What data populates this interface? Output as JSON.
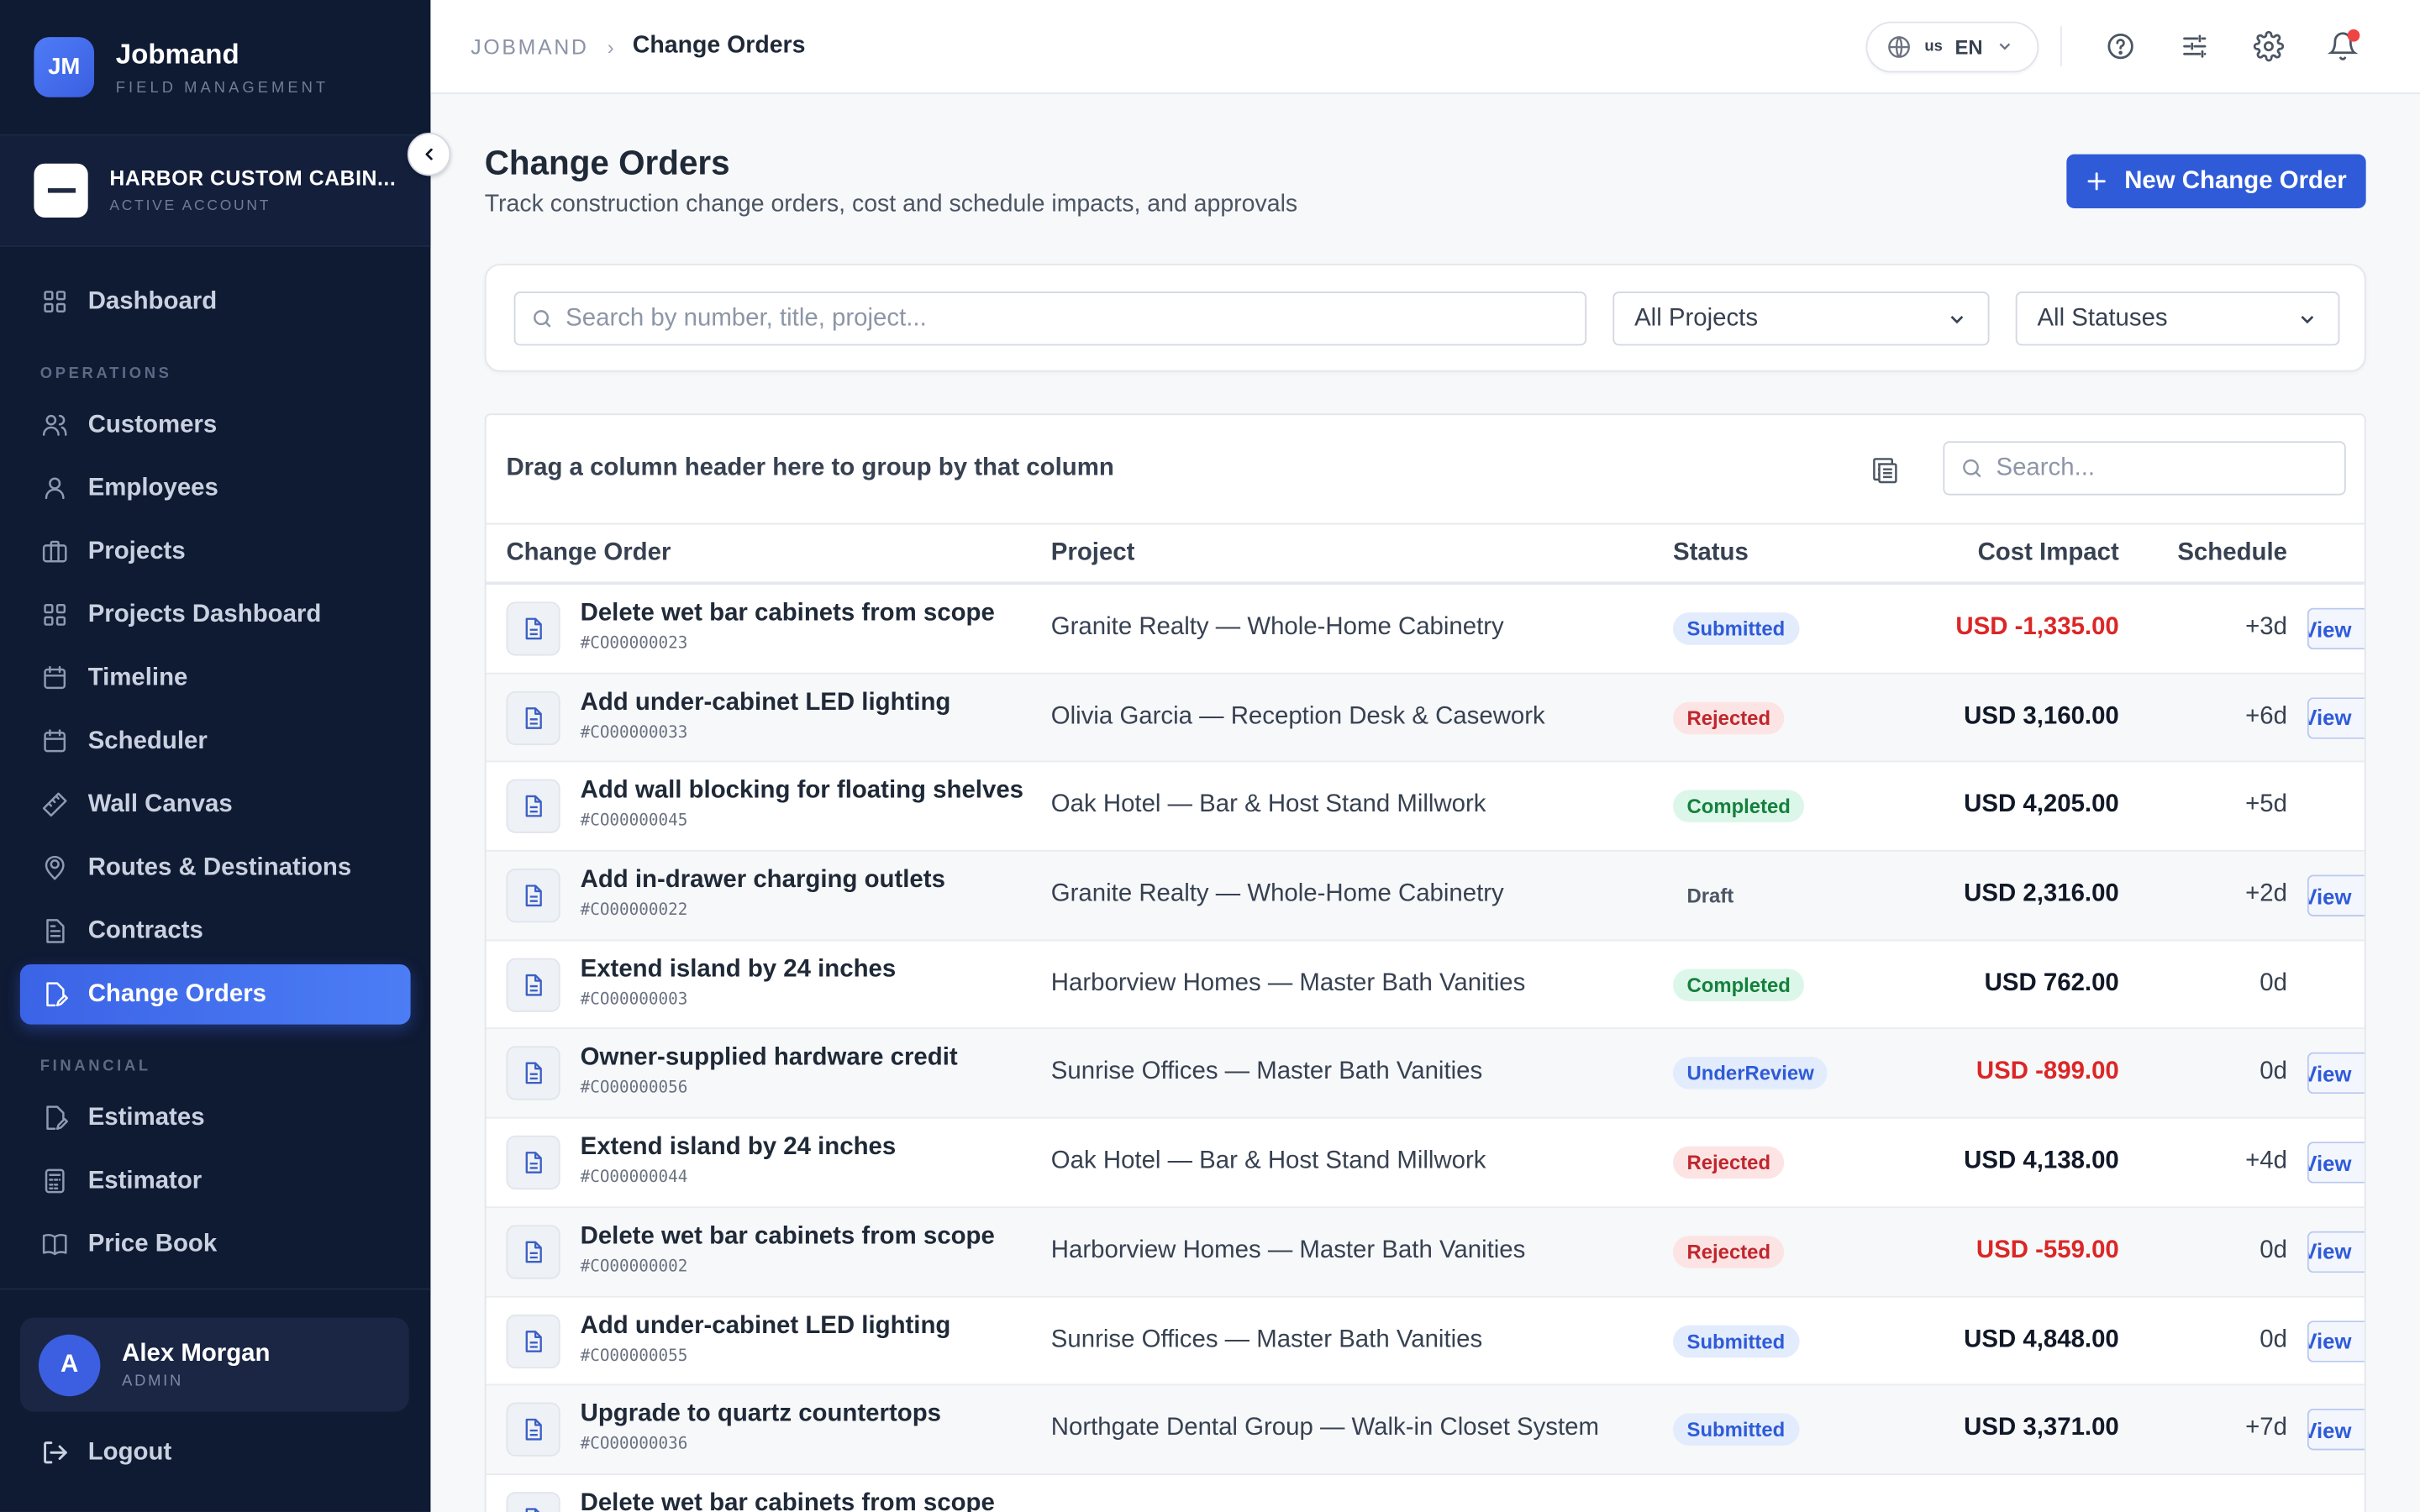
{
  "brand": {
    "initials": "JM",
    "name": "Jobmand",
    "subtitle": "FIELD MANAGEMENT"
  },
  "account": {
    "name": "HARBOR CUSTOM CABIN...",
    "status": "ACTIVE ACCOUNT"
  },
  "nav": {
    "top": [
      {
        "label": "Dashboard",
        "icon": "grid-icon"
      }
    ],
    "operations_label": "OPERATIONS",
    "operations": [
      {
        "label": "Customers",
        "icon": "users-icon"
      },
      {
        "label": "Employees",
        "icon": "user-icon"
      },
      {
        "label": "Projects",
        "icon": "briefcase-icon"
      },
      {
        "label": "Projects Dashboard",
        "icon": "grid-icon"
      },
      {
        "label": "Timeline",
        "icon": "calendar-icon"
      },
      {
        "label": "Scheduler",
        "icon": "calendar-icon"
      },
      {
        "label": "Wall Canvas",
        "icon": "ruler-icon"
      },
      {
        "label": "Routes & Destinations",
        "icon": "map-pin-icon"
      },
      {
        "label": "Contracts",
        "icon": "document-icon"
      },
      {
        "label": "Change Orders",
        "icon": "document-edit-icon",
        "active": true
      }
    ],
    "financial_label": "FINANCIAL",
    "financial": [
      {
        "label": "Estimates",
        "icon": "document-edit-icon"
      },
      {
        "label": "Estimator",
        "icon": "calculator-icon"
      },
      {
        "label": "Price Book",
        "icon": "book-icon"
      }
    ]
  },
  "user": {
    "initial": "A",
    "name": "Alex Morgan",
    "role": "ADMIN"
  },
  "logout_label": "Logout",
  "breadcrumb": {
    "root": "JOBMAND",
    "current": "Change Orders"
  },
  "language": {
    "flag": "us",
    "code": "EN"
  },
  "page": {
    "title": "Change Orders",
    "subtitle": "Track construction change orders, cost and schedule impacts, and approvals",
    "new_button": "New Change Order"
  },
  "filters": {
    "search_placeholder": "Search by number, title, project...",
    "project_select": "All Projects",
    "status_select": "All Statuses"
  },
  "grid": {
    "group_hint": "Drag a column header here to group by that column",
    "search_placeholder": "Search...",
    "columns": {
      "change_order": "Change Order",
      "project": "Project",
      "status": "Status",
      "cost": "Cost Impact",
      "schedule": "Schedule"
    },
    "view_label": "View",
    "rows": [
      {
        "title": "Delete wet bar cabinets from scope",
        "number": "#CO00000023",
        "project": "Granite Realty — Whole-Home Cabinetry",
        "status": "Submitted",
        "cost": "USD -1,335.00",
        "negative": true,
        "schedule": "+3d",
        "view": true
      },
      {
        "title": "Add under-cabinet LED lighting",
        "number": "#CO00000033",
        "project": "Olivia Garcia — Reception Desk & Casework",
        "status": "Rejected",
        "cost": "USD 3,160.00",
        "negative": false,
        "schedule": "+6d",
        "view": true
      },
      {
        "title": "Add wall blocking for floating shelves",
        "number": "#CO00000045",
        "project": "Oak Hotel — Bar & Host Stand Millwork",
        "status": "Completed",
        "cost": "USD 4,205.00",
        "negative": false,
        "schedule": "+5d",
        "view": false
      },
      {
        "title": "Add in-drawer charging outlets",
        "number": "#CO00000022",
        "project": "Granite Realty — Whole-Home Cabinetry",
        "status": "Draft",
        "cost": "USD 2,316.00",
        "negative": false,
        "schedule": "+2d",
        "view": true
      },
      {
        "title": "Extend island by 24 inches",
        "number": "#CO00000003",
        "project": "Harborview Homes — Master Bath Vanities",
        "status": "Completed",
        "cost": "USD 762.00",
        "negative": false,
        "schedule": "0d",
        "view": false
      },
      {
        "title": "Owner-supplied hardware credit",
        "number": "#CO00000056",
        "project": "Sunrise Offices — Master Bath Vanities",
        "status": "UnderReview",
        "cost": "USD -899.00",
        "negative": true,
        "schedule": "0d",
        "view": true
      },
      {
        "title": "Extend island by 24 inches",
        "number": "#CO00000044",
        "project": "Oak Hotel — Bar & Host Stand Millwork",
        "status": "Rejected",
        "cost": "USD 4,138.00",
        "negative": false,
        "schedule": "+4d",
        "view": true
      },
      {
        "title": "Delete wet bar cabinets from scope",
        "number": "#CO00000002",
        "project": "Harborview Homes — Master Bath Vanities",
        "status": "Rejected",
        "cost": "USD -559.00",
        "negative": true,
        "schedule": "0d",
        "view": true
      },
      {
        "title": "Add under-cabinet LED lighting",
        "number": "#CO00000055",
        "project": "Sunrise Offices — Master Bath Vanities",
        "status": "Submitted",
        "cost": "USD 4,848.00",
        "negative": false,
        "schedule": "0d",
        "view": true
      },
      {
        "title": "Upgrade to quartz countertops",
        "number": "#CO00000036",
        "project": "Northgate Dental Group — Walk-in Closet System",
        "status": "Submitted",
        "cost": "USD 3,371.00",
        "negative": false,
        "schedule": "+7d",
        "view": true
      },
      {
        "title": "Delete wet bar cabinets from scope",
        "number": "",
        "project": "",
        "status": "",
        "cost": "",
        "negative": false,
        "schedule": "",
        "view": false
      }
    ]
  },
  "colors": {
    "sidebar_bg": "#0f1a33",
    "accent": "#2f5bd8",
    "negative": "#dc2626"
  }
}
